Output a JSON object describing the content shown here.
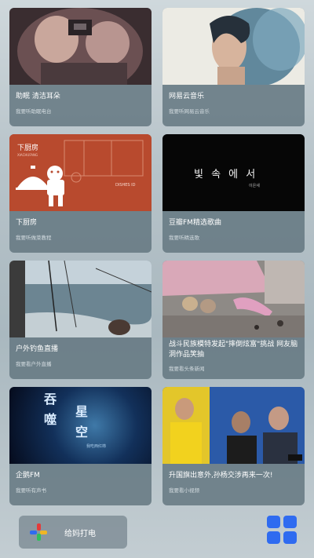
{
  "cards": [
    {
      "title": "助眠 清洁耳朵",
      "subtitle": "我要听助眠电台"
    },
    {
      "title": "网易云音乐",
      "subtitle": "我要听网易云音乐"
    },
    {
      "title": "下厨房",
      "subtitle": "我要听做菜教程",
      "thumb_top_text": "下厨房",
      "thumb_small_text": "XIACHUFANG",
      "thumb_side_text": "DISHES ID"
    },
    {
      "title": "豆瓣FM精选歌曲",
      "subtitle": "我要听精选歌",
      "thumb_text": "빛 속 에 서",
      "thumb_small_text": "이은새"
    },
    {
      "title": "户外钓鱼直播",
      "subtitle": "我要看户外直播"
    },
    {
      "title": "战斗民族模特发起\"摔倒炫富\"挑战 网友脑洞作品笑抽",
      "subtitle": "我要看头条新闻"
    },
    {
      "title": "企鹅FM",
      "subtitle": "我要听有声书",
      "thumb_text_1": "吞",
      "thumb_text_2": "噬",
      "thumb_text_3": "星",
      "thumb_text_4": "空",
      "thumb_small_text": "我吃西红柿"
    },
    {
      "title": "升国旗出意外,孙杨交涉再来一次!",
      "subtitle": "我要看小视频"
    }
  ],
  "dock": {
    "call_label": "给妈打电",
    "plus_icon": "plus-icon",
    "apps_icon": "apps-grid-icon"
  },
  "colors": {
    "card_bg": "#60747E",
    "red_thumb": "#B84A2E",
    "blue_tile": "#2F6BF0"
  }
}
